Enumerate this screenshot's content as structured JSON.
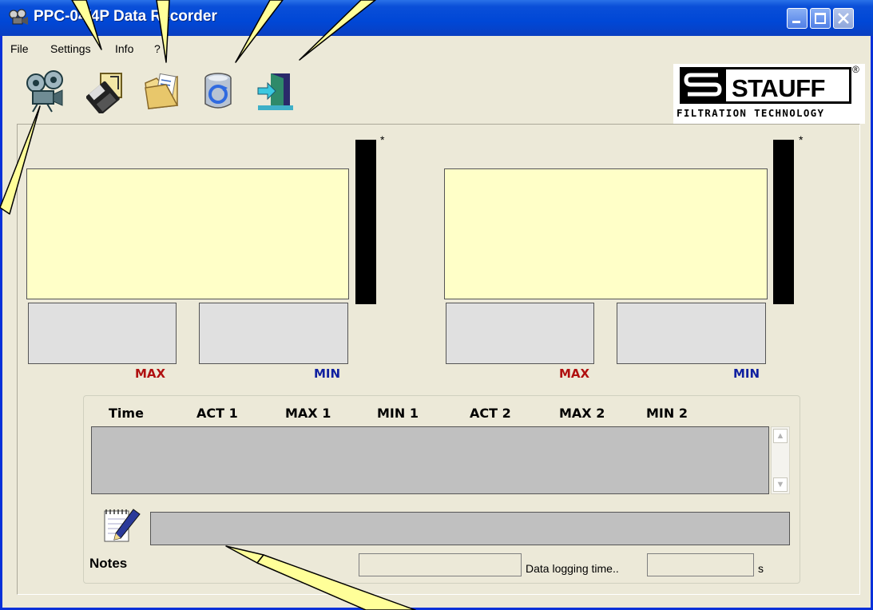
{
  "window": {
    "title": "PPC-04/4P Data Recorder"
  },
  "menu": [
    "File",
    "Settings",
    "Info",
    "?"
  ],
  "toolbar": {
    "icons": [
      "camera-icon",
      "floppy-disk-icon",
      "folder-icon",
      "database-refresh-icon",
      "exit-door-icon"
    ]
  },
  "logo": {
    "name": "STAUFF",
    "subtitle": "FILTRATION TECHNOLOGY",
    "reg": "®"
  },
  "channel1": {
    "asterisk": "*",
    "max_label": "MAX",
    "min_label": "MIN"
  },
  "channel2": {
    "asterisk": "*",
    "max_label": "MAX",
    "min_label": "MIN"
  },
  "log": {
    "columns": [
      "Time",
      "ACT 1",
      "MAX 1",
      "MIN 1",
      "ACT 2",
      "MAX 2",
      "MIN 2"
    ]
  },
  "notes": {
    "label": "Notes",
    "value": ""
  },
  "logging": {
    "label": "Data logging time..",
    "unit": "s",
    "value": ""
  },
  "colors": {
    "display_bg": "#ffffc8",
    "max_color": "#b01010",
    "min_color": "#1020a0",
    "titlebar": "#0047d6"
  }
}
